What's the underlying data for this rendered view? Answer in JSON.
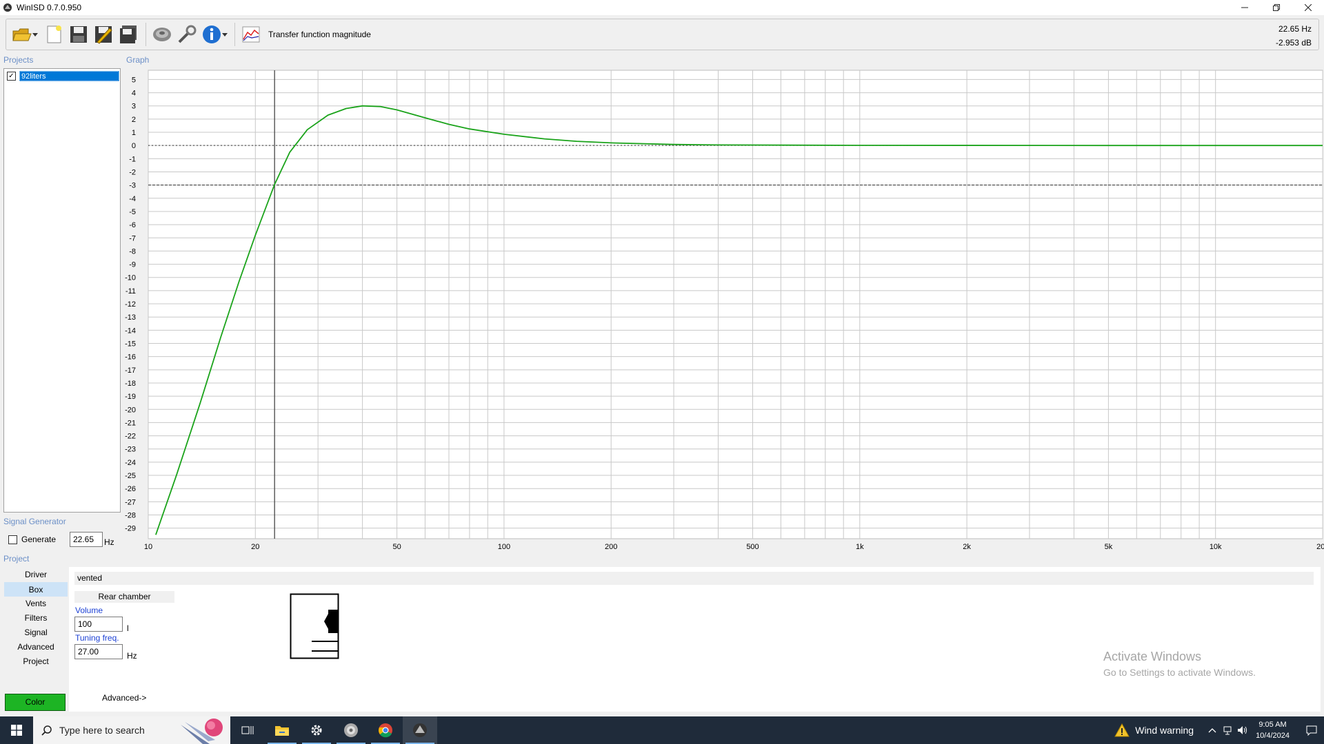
{
  "window": {
    "title": "WinISD 0.7.0.950",
    "controls": [
      "minimize",
      "restore",
      "close"
    ]
  },
  "toolbar": {
    "buttons": [
      {
        "name": "open-project",
        "icon": "folder-open-icon"
      },
      {
        "name": "new-project",
        "icon": "new-document-icon"
      },
      {
        "name": "save",
        "icon": "floppy-disk-icon"
      },
      {
        "name": "save-as",
        "icon": "floppy-pencil-icon"
      },
      {
        "name": "save-all",
        "icon": "floppy-stack-icon"
      },
      {
        "name": "driver-editor",
        "icon": "speaker-icon"
      },
      {
        "name": "tools",
        "icon": "wrench-icon"
      },
      {
        "name": "info",
        "icon": "info-icon"
      },
      {
        "name": "graph-type",
        "icon": "graph-icon"
      }
    ],
    "graph_mode_label": "Transfer function magnitude"
  },
  "cursor_readout": {
    "frequency": "22.65 Hz",
    "level": "-2.953 dB"
  },
  "sections": {
    "projects": "Projects",
    "graph": "Graph",
    "signal_generator": "Signal Generator",
    "project": "Project"
  },
  "projects": [
    {
      "name": "92liters",
      "checked": true,
      "selected": true
    }
  ],
  "signal_generator": {
    "generate_label": "Generate",
    "generate_checked": false,
    "frequency": "22.65",
    "unit": "Hz"
  },
  "project_nav": {
    "items": [
      "Driver",
      "Box",
      "Vents",
      "Filters",
      "Signal",
      "Advanced",
      "Project"
    ],
    "active": "Box",
    "color_button": "Color",
    "color_value": "#1db424"
  },
  "box": {
    "type": "vented",
    "rear_chamber_label": "Rear chamber",
    "volume_label": "Volume",
    "volume_value": "100",
    "volume_unit": "l",
    "tuning_label": "Tuning freq.",
    "tuning_value": "27.00",
    "tuning_unit": "Hz",
    "advanced_link": "Advanced->"
  },
  "watermark": {
    "line1": "Activate Windows",
    "line2": "Go to Settings to activate Windows."
  },
  "taskbar": {
    "search_placeholder": "Type here to search",
    "apps": [
      "task-view",
      "file-explorer",
      "settings",
      "winisd-driver",
      "chrome",
      "winisd"
    ],
    "weather": "Wind warning",
    "time": "9:05 AM",
    "date": "10/4/2024"
  },
  "chart_data": {
    "type": "line",
    "x_scale": "log",
    "xlim": [
      10,
      20000
    ],
    "ylim": [
      -29,
      5
    ],
    "grid": true,
    "x_tick_labels": [
      {
        "value": 10,
        "label": "10"
      },
      {
        "value": 20,
        "label": "20"
      },
      {
        "value": 50,
        "label": "50"
      },
      {
        "value": 100,
        "label": "100"
      },
      {
        "value": 200,
        "label": "200"
      },
      {
        "value": 500,
        "label": "500"
      },
      {
        "value": 1000,
        "label": "1k"
      },
      {
        "value": 2000,
        "label": "2k"
      },
      {
        "value": 5000,
        "label": "5k"
      },
      {
        "value": 10000,
        "label": "10k"
      },
      {
        "value": 20000,
        "label": "20k"
      }
    ],
    "y_ticks": [
      5,
      4,
      3,
      2,
      1,
      0,
      -1,
      -2,
      -3,
      -4,
      -5,
      -6,
      -7,
      -8,
      -9,
      -10,
      -11,
      -12,
      -13,
      -14,
      -15,
      -16,
      -17,
      -18,
      -19,
      -20,
      -21,
      -22,
      -23,
      -24,
      -25,
      -26,
      -27,
      -28,
      -29
    ],
    "reference_lines_db": [
      0,
      -3
    ],
    "cursor_x": 22.65,
    "series": [
      {
        "color": "#1aa31a",
        "x": [
          10.5,
          12,
          14,
          16,
          18,
          20,
          22.65,
          25,
          28,
          32,
          36,
          40,
          45,
          50,
          60,
          70,
          80,
          100,
          130,
          160,
          200,
          300,
          400,
          1000,
          5000,
          20000
        ],
        "y": [
          -29.5,
          -25,
          -19.5,
          -14.5,
          -10.3,
          -6.8,
          -2.95,
          -0.5,
          1.2,
          2.3,
          2.8,
          3.0,
          2.95,
          2.7,
          2.1,
          1.6,
          1.25,
          0.85,
          0.5,
          0.32,
          0.2,
          0.08,
          0.04,
          0.01,
          0.0,
          0.0
        ]
      }
    ]
  }
}
